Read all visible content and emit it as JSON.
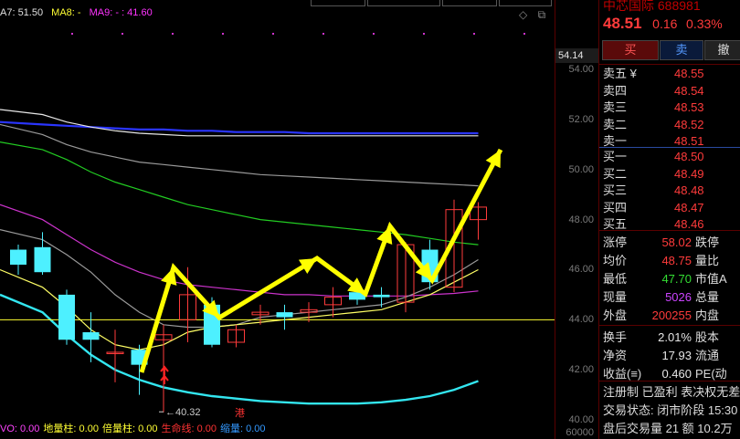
{
  "ma_legend": {
    "ma7": "A7: 51.50",
    "ma8": "MA8: -",
    "ma9": "MA9: - : 41.60"
  },
  "colors": {
    "ma7": "#e0e0e0",
    "ma8": "#ffff33",
    "ma9": "#ff33ff",
    "up": "#ff3b3b",
    "down": "#4df0ff",
    "arrow": "#ffff00",
    "ma_blue": "#2a35ff",
    "ma_white": "#e8e8e8",
    "ma_green": "#22cc22",
    "ma_grey": "#9a9a9a",
    "ma_magenta": "#cc33cc",
    "ma_yellow": "#ffff66",
    "ma_cyan": "#33e6f0"
  },
  "y_axis": {
    "current_tag": "54.14",
    "ticks": [
      "54.00",
      "52.00",
      "50.00",
      "48.00",
      "46.00",
      "44.00",
      "42.00",
      "40.00",
      "60000"
    ]
  },
  "annotations": {
    "low_label": "40.32",
    "marker_label": "港"
  },
  "bottom_legend": [
    {
      "text": "VO: 0.00",
      "color": "#ff44ff"
    },
    {
      "text": "地量柱: 0.00",
      "color": "#ffff33"
    },
    {
      "text": "倍量柱: 0.00",
      "color": "#ffff33"
    },
    {
      "text": "生命线: 0.00",
      "color": "#ff3333"
    },
    {
      "text": "缩量: 0.00",
      "color": "#3399ff"
    }
  ],
  "chart_data": {
    "type": "candlestick",
    "title": "",
    "ylim": [
      40.0,
      54.5
    ],
    "candles": [
      {
        "o": 46.8,
        "h": 47.0,
        "l": 45.8,
        "c": 46.2
      },
      {
        "o": 46.9,
        "h": 47.5,
        "l": 45.8,
        "c": 45.9
      },
      {
        "o": 45.0,
        "h": 45.2,
        "l": 43.0,
        "c": 43.2
      },
      {
        "o": 43.5,
        "h": 44.3,
        "l": 42.3,
        "c": 43.2
      },
      {
        "o": 42.7,
        "h": 43.6,
        "l": 41.5,
        "c": 42.7
      },
      {
        "o": 42.8,
        "h": 43.0,
        "l": 41.0,
        "c": 42.2
      },
      {
        "o": 43.2,
        "h": 43.8,
        "l": 40.3,
        "c": 43.4
      },
      {
        "o": 44.0,
        "h": 46.1,
        "l": 43.1,
        "c": 45.0
      },
      {
        "o": 44.6,
        "h": 44.9,
        "l": 42.9,
        "c": 43.0
      },
      {
        "o": 43.1,
        "h": 43.8,
        "l": 42.9,
        "c": 43.6
      },
      {
        "o": 44.2,
        "h": 44.6,
        "l": 43.8,
        "c": 44.3
      },
      {
        "o": 44.3,
        "h": 44.6,
        "l": 43.6,
        "c": 44.1
      },
      {
        "o": 44.3,
        "h": 44.7,
        "l": 43.9,
        "c": 44.4
      },
      {
        "o": 44.6,
        "h": 45.3,
        "l": 44.1,
        "c": 44.9
      },
      {
        "o": 45.1,
        "h": 45.3,
        "l": 44.6,
        "c": 44.8
      },
      {
        "o": 45.0,
        "h": 45.3,
        "l": 44.5,
        "c": 44.9
      },
      {
        "o": 44.7,
        "h": 47.1,
        "l": 44.3,
        "c": 47.0
      },
      {
        "o": 46.8,
        "h": 47.2,
        "l": 45.2,
        "c": 45.5
      },
      {
        "o": 45.3,
        "h": 48.8,
        "l": 45.1,
        "c": 48.4
      },
      {
        "o": 48.0,
        "h": 48.7,
        "l": 47.2,
        "c": 48.5
      }
    ],
    "ma_lines": [
      {
        "name": "ma_blue",
        "values": [
          51.9,
          51.8,
          51.75,
          51.7,
          51.65,
          51.6,
          51.6,
          51.55,
          51.55,
          51.5,
          51.5,
          51.5,
          51.45,
          51.45,
          51.45,
          51.45,
          51.45,
          51.45,
          51.45,
          51.45
        ]
      },
      {
        "name": "ma_white",
        "values": [
          52.4,
          52.2,
          51.9,
          51.7,
          51.55,
          51.45,
          51.4,
          51.35,
          51.35,
          51.35,
          51.35,
          51.35,
          51.35,
          51.35,
          51.35,
          51.35,
          51.35,
          51.35,
          51.35,
          51.35
        ]
      },
      {
        "name": "ma_grey",
        "values": [
          51.8,
          51.4,
          51.0,
          50.7,
          50.5,
          50.3,
          50.2,
          50.1,
          50.0,
          49.9,
          49.8,
          49.75,
          49.7,
          49.65,
          49.6,
          49.55,
          49.5,
          49.45,
          49.4,
          49.35
        ]
      },
      {
        "name": "ma_green",
        "values": [
          51.1,
          50.8,
          50.4,
          49.9,
          49.5,
          49.2,
          48.9,
          48.6,
          48.4,
          48.2,
          48.0,
          47.9,
          47.8,
          47.7,
          47.6,
          47.5,
          47.4,
          47.25,
          47.1,
          47.0
        ]
      },
      {
        "name": "ma_magenta",
        "values": [
          48.6,
          48.0,
          47.4,
          46.8,
          46.3,
          45.9,
          45.6,
          45.4,
          45.3,
          45.2,
          45.1,
          45.0,
          45.0,
          44.95,
          44.95,
          44.95,
          44.95,
          45.0,
          45.05,
          45.15
        ]
      },
      {
        "name": "ma_grey",
        "values": [
          47.6,
          47.2,
          46.6,
          45.9,
          45.0,
          44.3,
          43.8,
          43.7,
          43.7,
          43.8,
          44.1,
          44.2,
          44.3,
          44.4,
          44.5,
          44.6,
          44.9,
          45.3,
          45.8,
          46.4
        ]
      },
      {
        "name": "ma_yellow",
        "values": [
          46.0,
          45.3,
          44.5,
          43.6,
          43.0,
          42.8,
          43.0,
          43.5,
          43.7,
          43.8,
          43.9,
          44.0,
          44.1,
          44.2,
          44.3,
          44.4,
          44.7,
          45.0,
          45.5,
          46.0
        ]
      },
      {
        "name": "ma_cyan",
        "values": [
          45.0,
          44.3,
          43.4,
          42.6,
          42.0,
          41.6,
          41.3,
          41.1,
          40.95,
          40.85,
          40.75,
          40.7,
          40.65,
          40.65,
          40.65,
          40.7,
          40.8,
          40.95,
          41.2,
          41.55
        ]
      }
    ],
    "hline": 44.0
  },
  "quote": {
    "title": "中芯国际 688981",
    "price": "48.51",
    "change": "0.16",
    "change_pct": "0.33%",
    "buy_label": "买",
    "sell_label": "卖",
    "cancel_label": "撤",
    "asks": [
      {
        "label": "卖五 ¥",
        "price": "48.55"
      },
      {
        "label": "卖四",
        "price": "48.54"
      },
      {
        "label": "卖三",
        "price": "48.53"
      },
      {
        "label": "卖二",
        "price": "48.52"
      },
      {
        "label": "卖一",
        "price": "48.51"
      }
    ],
    "bids": [
      {
        "label": "买一",
        "price": "48.50"
      },
      {
        "label": "买二",
        "price": "48.49"
      },
      {
        "label": "买三",
        "price": "48.48"
      },
      {
        "label": "买四",
        "price": "48.47"
      },
      {
        "label": "买五",
        "price": "48.46"
      }
    ],
    "stats": [
      {
        "l1": "涨停",
        "v1": "58.02",
        "c1": "red",
        "l2": "跌停"
      },
      {
        "l1": "均价",
        "v1": "48.75",
        "c1": "red",
        "l2": "量比"
      },
      {
        "l1": "最低",
        "v1": "47.70",
        "c1": "green",
        "l2": "市值A"
      },
      {
        "l1": "现量",
        "v1": "5026",
        "c1": "purple",
        "l2": "总量"
      },
      {
        "l1": "外盘",
        "v1": "200255",
        "c1": "red",
        "l2": "内盘"
      }
    ],
    "stats2": [
      {
        "l1": "换手",
        "v1": "2.01%",
        "c1": "white",
        "l2": "股本"
      },
      {
        "l1": "净资",
        "v1": "17.93",
        "c1": "white",
        "l2": "流通"
      },
      {
        "l1": "收益(≡)",
        "v1": "0.460",
        "c1": "white",
        "l2": "PE(动"
      }
    ],
    "info": [
      "注册制 已盈利 表决权无差",
      "交易状态: 闭市阶段 15:30",
      "盘后交易量 21 额 10.2万"
    ]
  }
}
